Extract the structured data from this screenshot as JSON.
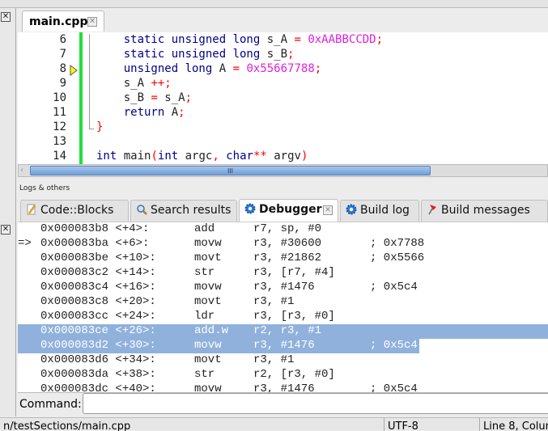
{
  "editor": {
    "tab_label": "main.cpp",
    "close_glyph": "✕",
    "lines": [
      {
        "n": "6",
        "parts": [
          [
            "    ",
            ""
          ],
          [
            "static unsigned long",
            "kw"
          ],
          [
            " s_A ",
            ""
          ],
          [
            "=",
            "op"
          ],
          [
            " ",
            ""
          ],
          [
            "0xAABBCCDD",
            "num"
          ],
          [
            ";",
            "op"
          ]
        ]
      },
      {
        "n": "7",
        "parts": [
          [
            "    ",
            ""
          ],
          [
            "static unsigned long",
            "kw"
          ],
          [
            " s_B",
            ""
          ],
          [
            ";",
            "op"
          ]
        ]
      },
      {
        "n": "8",
        "parts": [
          [
            "    ",
            ""
          ],
          [
            "unsigned long",
            "kw"
          ],
          [
            " A ",
            ""
          ],
          [
            "=",
            "op"
          ],
          [
            " ",
            ""
          ],
          [
            "0x55667788",
            "num"
          ],
          [
            ";",
            "op"
          ]
        ]
      },
      {
        "n": "9",
        "parts": [
          [
            "    s_A ",
            ""
          ],
          [
            "++;",
            "op"
          ]
        ]
      },
      {
        "n": "10",
        "parts": [
          [
            "    s_B ",
            ""
          ],
          [
            "=",
            "op"
          ],
          [
            " s_A",
            ""
          ],
          [
            ";",
            "op"
          ]
        ]
      },
      {
        "n": "11",
        "parts": [
          [
            "    ",
            ""
          ],
          [
            "return",
            "kw"
          ],
          [
            " A",
            ""
          ],
          [
            ";",
            "op"
          ]
        ]
      },
      {
        "n": "12",
        "parts": [
          [
            "}",
            "op"
          ]
        ]
      },
      {
        "n": "13",
        "parts": []
      },
      {
        "n": "14",
        "parts": [
          [
            "int",
            "kw"
          ],
          [
            " main",
            ""
          ],
          [
            "(",
            "op"
          ],
          [
            "int",
            "kw"
          ],
          [
            " argc",
            ""
          ],
          [
            ",",
            "op"
          ],
          [
            " ",
            ""
          ],
          [
            "char",
            "kw"
          ],
          [
            "**",
            "op"
          ],
          [
            " argv",
            ""
          ],
          [
            ")",
            "op"
          ]
        ]
      }
    ],
    "current_line": "8",
    "scroll_grip": "III"
  },
  "logs": {
    "title": "Logs & others",
    "tabs": [
      {
        "label": "Code::Blocks",
        "icon": "pencil-icon"
      },
      {
        "label": "Search results",
        "icon": "magnifier-icon"
      },
      {
        "label": "Debugger",
        "icon": "gear-icon",
        "active": true
      },
      {
        "label": "Build log",
        "icon": "gear-icon"
      },
      {
        "label": "Build messages",
        "icon": "pin-icon"
      }
    ]
  },
  "disasm": {
    "rows": [
      {
        "m": "",
        "a": "0x000083b8 <+4>:",
        "i": "add",
        "o": "r7, sp, #0",
        "c": ""
      },
      {
        "m": "=>",
        "a": "0x000083ba <+6>:",
        "i": "movw",
        "o": "r3, #30600",
        "c": "; 0x7788"
      },
      {
        "m": "",
        "a": "0x000083be <+10>:",
        "i": "movt",
        "o": "r3, #21862",
        "c": "; 0x5566"
      },
      {
        "m": "",
        "a": "0x000083c2 <+14>:",
        "i": "str",
        "o": "r3, [r7, #4]",
        "c": ""
      },
      {
        "m": "",
        "a": "0x000083c4 <+16>:",
        "i": "movw",
        "o": "r3, #1476",
        "c": "; 0x5c4"
      },
      {
        "m": "",
        "a": "0x000083c8 <+20>:",
        "i": "movt",
        "o": "r3, #1",
        "c": ""
      },
      {
        "m": "",
        "a": "0x000083cc <+24>:",
        "i": "ldr",
        "o": "r3, [r3, #0]",
        "c": ""
      },
      {
        "m": "",
        "a": "0x000083ce <+26>:",
        "i": "add.w",
        "o": "r2, r3, #1",
        "c": "",
        "sel": 1
      },
      {
        "m": "",
        "a": "0x000083d2 <+30>:",
        "i": "movw",
        "o": "r3, #1476",
        "c": "; 0x5c4",
        "sel": 2
      },
      {
        "m": "",
        "a": "0x000083d6 <+34>:",
        "i": "movt",
        "o": "r3, #1",
        "c": ""
      },
      {
        "m": "",
        "a": "0x000083da <+38>:",
        "i": "str",
        "o": "r2, [r3, #0]",
        "c": ""
      },
      {
        "m": "",
        "a": "0x000083dc <+40>:",
        "i": "movw",
        "o": "r3, #1476",
        "c": "; 0x5c4"
      }
    ]
  },
  "command": {
    "label": "Command:",
    "value": ""
  },
  "status": {
    "path": "n/testSections/main.cpp",
    "encoding": "UTF-8",
    "position": "Line 8, Colum"
  }
}
